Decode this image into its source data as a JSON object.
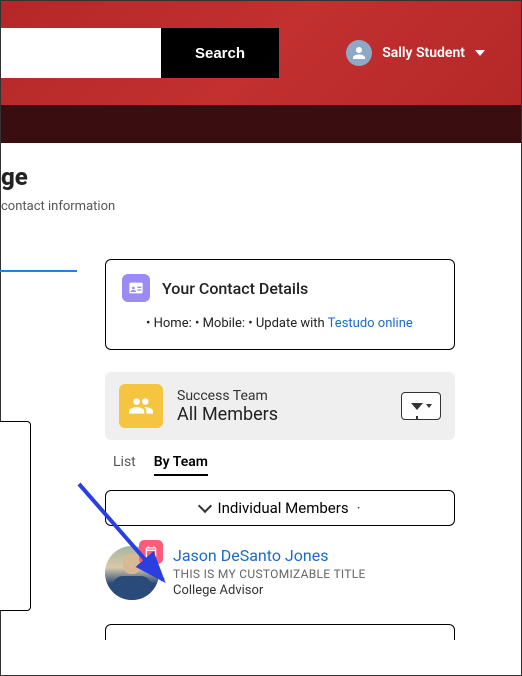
{
  "header": {
    "search_placeholder": "",
    "search_button": "Search",
    "user_name": "Sally Student"
  },
  "page": {
    "title_fragment": "ge",
    "subtitle_fragment": "contact information"
  },
  "contact_card": {
    "title": "Your Contact Details",
    "line_prefix": "• Home: • Mobile: • Update with ",
    "link_text": "Testudo online"
  },
  "team_card": {
    "label": "Success Team",
    "main": "All Members"
  },
  "tabs": {
    "list": "List",
    "by_team": "By Team"
  },
  "accordion": {
    "label": "Individual Members",
    "suffix": "·"
  },
  "member": {
    "name": "Jason DeSanto Jones",
    "custom_title": "THIS IS MY CUSTOMIZABLE TITLE",
    "role": "College Advisor"
  }
}
